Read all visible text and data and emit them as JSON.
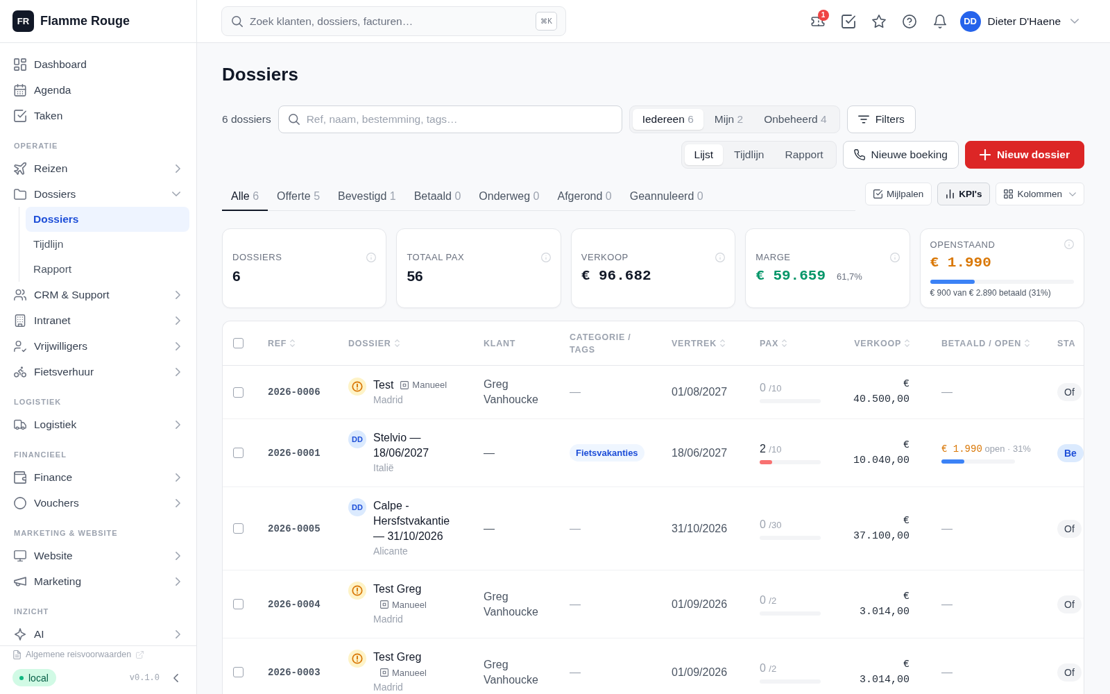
{
  "sidebar": {
    "logo": "FR",
    "brand": "Flamme Rouge",
    "sections": [
      {
        "items": [
          {
            "label": "Dashboard",
            "selected": false
          },
          {
            "label": "Agenda",
            "selected": false
          },
          {
            "label": "Taken",
            "selected": false
          }
        ]
      },
      {
        "heading": "OPERATIE",
        "items": [
          {
            "label": "Reizen",
            "selected": false,
            "expanded": false
          },
          {
            "label": "Dossiers",
            "selected": false,
            "expanded": true,
            "children": [
              {
                "label": "Dossiers",
                "selected": true
              },
              {
                "label": "Tijdlijn",
                "selected": false
              },
              {
                "label": "Rapport",
                "selected": false
              }
            ]
          },
          {
            "label": "CRM & Support",
            "selected": false,
            "expanded": false
          },
          {
            "label": "Intranet",
            "selected": false,
            "expanded": false
          },
          {
            "label": "Vrijwilligers",
            "selected": false,
            "expanded": false
          },
          {
            "label": "Fietsverhuur",
            "selected": false,
            "expanded": false
          }
        ]
      },
      {
        "heading": "LOGISTIEK",
        "items": [
          {
            "label": "Logistiek",
            "selected": false,
            "expanded": false
          }
        ]
      },
      {
        "heading": "FINANCIEEL",
        "items": [
          {
            "label": "Finance",
            "selected": false,
            "expanded": false
          },
          {
            "label": "Vouchers",
            "selected": false,
            "expanded": false
          }
        ]
      },
      {
        "heading": "MARKETING & WEBSITE",
        "items": [
          {
            "label": "Website",
            "selected": false,
            "expanded": false
          },
          {
            "label": "Marketing",
            "selected": false,
            "expanded": false
          }
        ]
      },
      {
        "heading": "INZICHT",
        "items": [
          {
            "label": "AI",
            "selected": false,
            "expanded": false
          }
        ]
      }
    ],
    "footer": {
      "link": "Algemene reisvoorwaarden",
      "environment": "local",
      "version": "v0.1.0"
    }
  },
  "topbar": {
    "search": {
      "placeholder": "Zoek klanten, dossiers, facturen…",
      "shortcut": "⌘K"
    },
    "notification_count": "1",
    "user": {
      "initials": "DD",
      "name": "Dieter D'Haene"
    }
  },
  "page": {
    "title": "Dossiers",
    "count": "6 dossiers",
    "search": {
      "placeholder": "Ref, naam, bestemming, tags…"
    },
    "owner_filter": [
      {
        "label": "Iedereen",
        "count": "6",
        "selected": true
      },
      {
        "label": "Mijn",
        "count": "2",
        "selected": false
      },
      {
        "label": "Onbeheerd",
        "count": "4",
        "selected": false
      }
    ],
    "filters_button": "Filters",
    "views": [
      {
        "label": "Lijst",
        "selected": true
      },
      {
        "label": "Tijdlijn",
        "selected": false
      },
      {
        "label": "Rapport",
        "selected": false
      }
    ],
    "new_booking_button": "Nieuwe boeking",
    "new_dossier_button": "Nieuw dossier",
    "status_tabs": [
      {
        "label": "Alle",
        "count": "6",
        "selected": true
      },
      {
        "label": "Offerte",
        "count": "5",
        "selected": false
      },
      {
        "label": "Bevestigd",
        "count": "1",
        "selected": false
      },
      {
        "label": "Betaald",
        "count": "0",
        "selected": false
      },
      {
        "label": "Onderweg",
        "count": "0",
        "selected": false
      },
      {
        "label": "Afgerond",
        "count": "0",
        "selected": false
      },
      {
        "label": "Geannuleerd",
        "count": "0",
        "selected": false
      }
    ],
    "milestones_toggle": {
      "label": "Mijlpalen",
      "on": false
    },
    "kpi_toggle": {
      "label": "KPI's",
      "on": true
    },
    "columns_button": "Kolommen"
  },
  "kpis": [
    {
      "kind": "count",
      "label": "DOSSIERS",
      "value": "6"
    },
    {
      "kind": "count",
      "label": "TOTAAL PAX",
      "value": "56"
    },
    {
      "kind": "money",
      "label": "VERKOOP",
      "value": "€ 96.682"
    },
    {
      "kind": "margin",
      "label": "MARGE",
      "value": "€ 59.659",
      "note": "61,7%"
    },
    {
      "kind": "outstanding",
      "label": "OPENSTAAND",
      "value": "€ 1.990",
      "level": 0.31,
      "caption": "€ 900 van € 2.890 betaald (31%)"
    }
  ],
  "table": {
    "all_checked": false,
    "columns": [
      {
        "label": "REF",
        "sortable": true
      },
      {
        "label": "DOSSIER",
        "sortable": true
      },
      {
        "label": "KLANT",
        "sortable": false
      },
      {
        "label": "CATEGORIE / TAGS",
        "sortable": false
      },
      {
        "label": "VERTREK",
        "sortable": true
      },
      {
        "label": "PAX",
        "sortable": true
      },
      {
        "label": "VERKOOP",
        "sortable": true
      },
      {
        "label": "BETAALD / OPEN",
        "sortable": true
      },
      {
        "label": "STA",
        "sortable": false
      }
    ],
    "rows": [
      {
        "checked": false,
        "ref": "2026-0006",
        "marker": {
          "kind": "warning"
        },
        "title": "Test",
        "source": "Manueel",
        "place": "Madrid",
        "client": "Greg Vanhoucke",
        "category": "—",
        "departure": "01/08/2027",
        "pax": {
          "count": "0",
          "capacity": "/10",
          "level": 0
        },
        "sale": "€ 40.500,00",
        "paid": {
          "kind": "none",
          "text": "—"
        },
        "status": {
          "kind": "neutral",
          "label": "Of"
        }
      },
      {
        "checked": false,
        "ref": "2026-0001",
        "marker": {
          "kind": "avatar",
          "initials": "DD"
        },
        "title": "Stelvio — 18/06/2027",
        "place": "Italië",
        "client": "—",
        "tags": [
          "Fietsvakanties"
        ],
        "departure": "18/06/2027",
        "pax": {
          "count": "2",
          "capacity": "/10",
          "level": 0.2
        },
        "sale": "€ 10.040,00",
        "paid": {
          "kind": "open",
          "amount": "€ 1.990",
          "note": "open · 31%",
          "level": 0.31
        },
        "status": {
          "kind": "info",
          "label": "Be"
        }
      },
      {
        "checked": false,
        "ref": "2026-0005",
        "marker": {
          "kind": "avatar",
          "initials": "DD"
        },
        "title": "Calpe - Hersfstvakantie — 31/10/2026",
        "place": "Alicante",
        "client": "—",
        "category": "—",
        "departure": "31/10/2026",
        "pax": {
          "count": "0",
          "capacity": "/30",
          "level": 0
        },
        "sale": "€ 37.100,00",
        "paid": {
          "kind": "none",
          "text": "—"
        },
        "status": {
          "kind": "neutral",
          "label": "Of"
        }
      },
      {
        "checked": false,
        "ref": "2026-0004",
        "marker": {
          "kind": "warning"
        },
        "title": "Test Greg",
        "source": "Manueel",
        "place": "Madrid",
        "client": "Greg Vanhoucke",
        "category": "—",
        "departure": "01/09/2026",
        "pax": {
          "count": "0",
          "capacity": "/2",
          "level": 0
        },
        "sale": "€ 3.014,00",
        "paid": {
          "kind": "none",
          "text": "—"
        },
        "status": {
          "kind": "neutral",
          "label": "Of"
        }
      },
      {
        "checked": false,
        "ref": "2026-0003",
        "marker": {
          "kind": "warning"
        },
        "title": "Test Greg",
        "source": "Manueel",
        "place": "Madrid",
        "client": "Greg Vanhoucke",
        "category": "—",
        "departure": "01/09/2026",
        "pax": {
          "count": "0",
          "capacity": "/2",
          "level": 0
        },
        "sale": "€ 3.014,00",
        "paid": {
          "kind": "none",
          "text": "—"
        },
        "status": {
          "kind": "neutral",
          "label": "Of"
        }
      }
    ]
  }
}
